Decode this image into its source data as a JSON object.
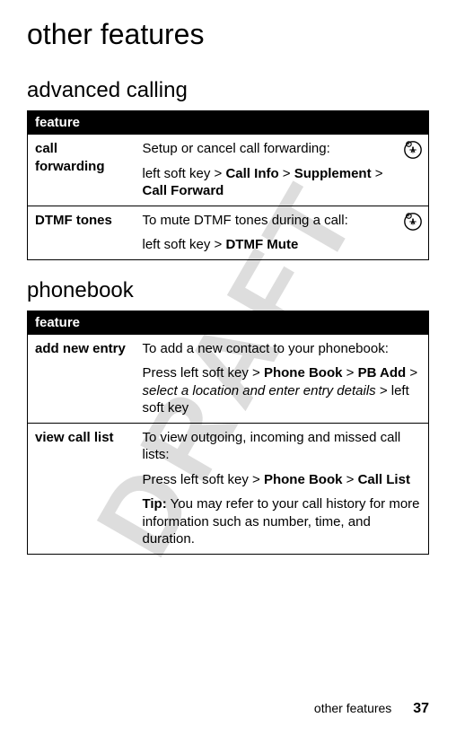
{
  "watermark": "DRAFT",
  "title": "other features",
  "sections": {
    "advanced_calling": {
      "heading": "advanced calling",
      "header": "feature",
      "rows": {
        "call_forwarding": {
          "name": "call forwarding",
          "intro": "Setup or cancel call forwarding:",
          "path_prefix": "left soft key > ",
          "path_p1": "Call Info",
          "path_sep1": " > ",
          "path_p2": "Supplement",
          "path_sep2": " > ",
          "path_p3": "Call Forward"
        },
        "dtmf": {
          "name": "DTMF tones",
          "intro": "To mute DTMF tones during a call:",
          "path_prefix": "left soft key > ",
          "path_p1": "DTMF Mute"
        }
      }
    },
    "phonebook": {
      "heading": "phonebook",
      "header": "feature",
      "rows": {
        "add_new_entry": {
          "name": "add new entry",
          "intro": "To add a new contact to your phonebook:",
          "path_prefix": "Press left soft key > ",
          "path_p1": "Phone Book",
          "path_sep1": " > ",
          "path_p2": "PB Add",
          "path_sep2": " > ",
          "path_italic": "select a location and enter entry details",
          "path_suffix": " > left soft key"
        },
        "view_call_list": {
          "name": "view call list",
          "intro": "To view outgoing, incoming and missed call lists:",
          "path_prefix": "Press left soft key > ",
          "path_p1": "Phone Book",
          "path_sep1": " > ",
          "path_p2": "Call List",
          "tip_label": "Tip:",
          "tip_text": " You may refer to your call history for more information such as number, time, and duration."
        }
      }
    }
  },
  "footer": {
    "label": "other features",
    "page": "37"
  }
}
